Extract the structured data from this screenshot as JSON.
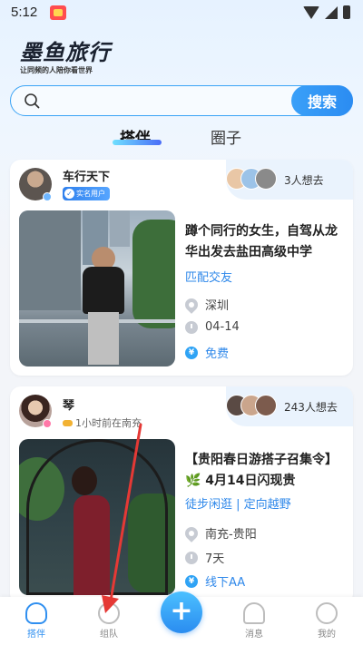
{
  "status_bar": {
    "time": "5:12"
  },
  "header": {
    "title": "墨鱼旅行",
    "slogan": "让同频的人陪你看世界"
  },
  "search": {
    "button_label": "搜索",
    "placeholder": ""
  },
  "tabs": [
    {
      "label": "搭伴",
      "active": true
    },
    {
      "label": "圈子",
      "active": false
    }
  ],
  "posts": [
    {
      "user_name": "车行天下",
      "badge": "实名用户",
      "want_count": "3人想去",
      "title": "蹲个同行的女生，自驾从龙华出发去盐田高级中学",
      "tags": "匹配交友",
      "location": "深圳",
      "date": "04-14",
      "price": "免费"
    },
    {
      "user_name": "琴",
      "last_seen": "1小时前在南充",
      "want_count": "243人想去",
      "title": "【贵阳春日游搭子召集令】🌿 4月14日闪现贵",
      "tags": "徒步闲逛 | 定向越野",
      "location": "南充-贵阳",
      "date": "7天",
      "price": "线下AA"
    }
  ],
  "bottom_nav": [
    {
      "label": "搭伴",
      "icon": "partner-icon",
      "active": true
    },
    {
      "label": "组队",
      "icon": "team-icon",
      "active": false
    },
    {
      "label": "",
      "icon": "plus-icon",
      "active": false
    },
    {
      "label": "消息",
      "icon": "bell-icon",
      "active": false
    },
    {
      "label": "我的",
      "icon": "profile-icon",
      "active": false
    }
  ],
  "colors": {
    "accent": "#2f8ff0",
    "annotation_arrow": "#e53935"
  }
}
